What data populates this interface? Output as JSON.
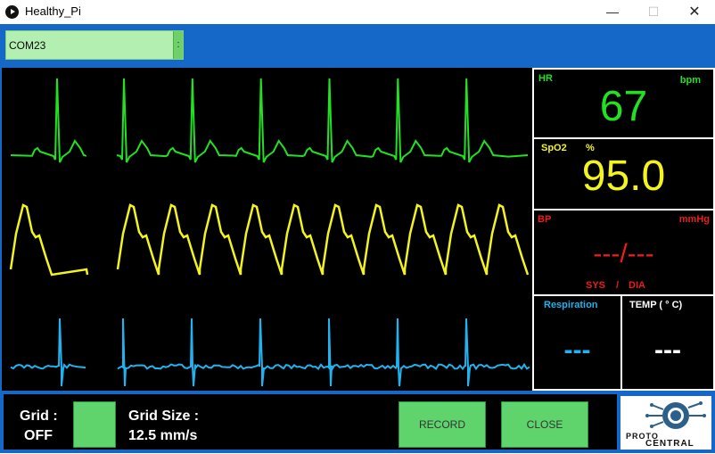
{
  "window": {
    "title": "Healthy_Pi",
    "minimize": "—",
    "maximize": "☐",
    "close": "✕"
  },
  "port": {
    "value": "COM23",
    "handle": ":"
  },
  "hr": {
    "label": "HR",
    "unit": "bpm",
    "value": "67",
    "color": "#22e022"
  },
  "spo2": {
    "label": "SpO2",
    "unit": "%",
    "value": "95.0",
    "color": "#f3f31e"
  },
  "bp": {
    "label": "BP",
    "unit": "mmHg",
    "value": "---/---",
    "sys": "SYS",
    "slash": "/",
    "dia": "DIA",
    "color": "#ee1c1c"
  },
  "resp": {
    "label": "Respiration",
    "value": "---",
    "color": "#21b3f0"
  },
  "temp": {
    "label": "TEMP ( ° C)",
    "value": "---",
    "color": "#ffffff"
  },
  "controls": {
    "grid_label": "Grid :",
    "grid_state": "OFF",
    "grid_size_label": "Grid Size :",
    "grid_size_value": "12.5 mm/s",
    "record": "RECORD",
    "close": "CLOSE"
  },
  "logo": {
    "line1": "PROTO",
    "line2": "CENTRAL"
  },
  "waves": {
    "ecg_color": "#22e022",
    "ppg_color": "#f3f31e",
    "resp_color": "#21b3f0"
  }
}
